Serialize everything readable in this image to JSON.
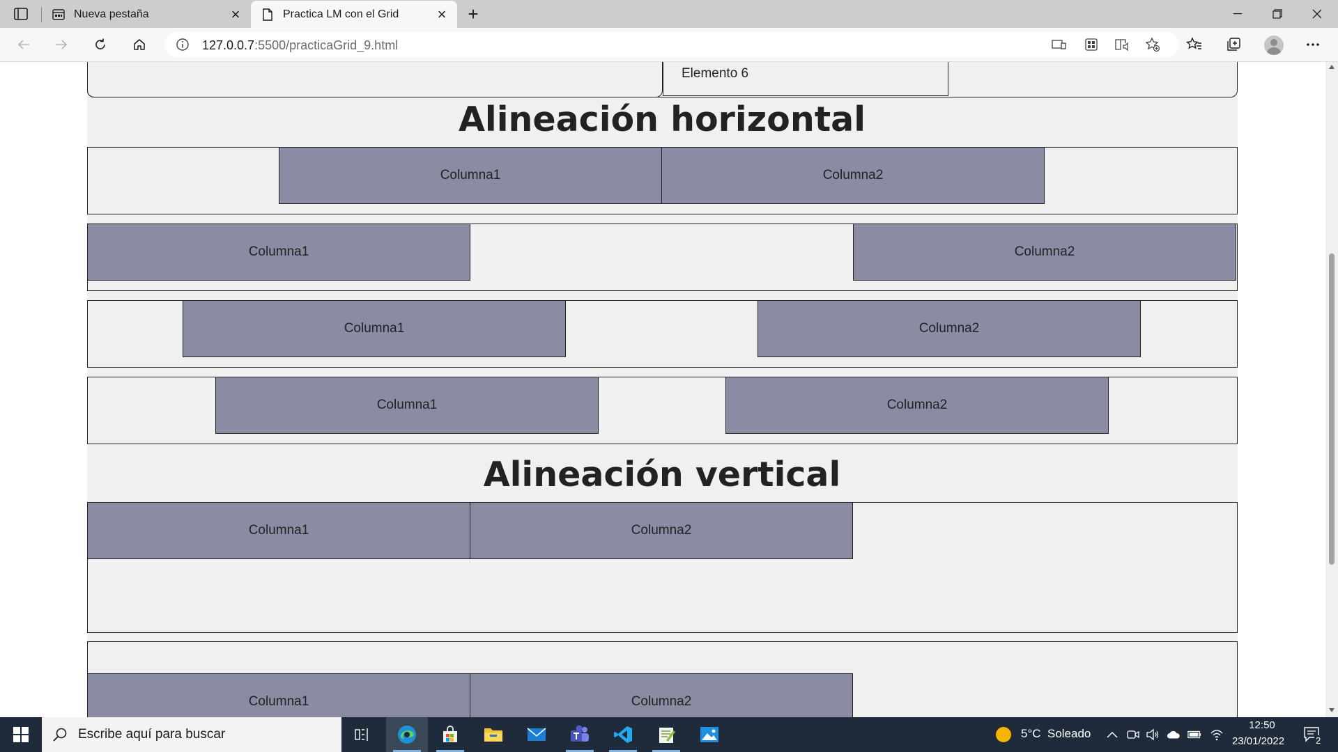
{
  "browser": {
    "tabs": [
      {
        "title": "Nueva pestaña",
        "active": false
      },
      {
        "title": "Practica LM con el Grid",
        "active": true
      }
    ],
    "url_host": "127.0.0.7",
    "url_path": ":5500/practicaGrid_9.html"
  },
  "page": {
    "top_element_label": "Elemento 6",
    "heading_horizontal": "Alineación horizontal",
    "heading_vertical": "Alineación vertical",
    "column1_label": "Columna1",
    "column2_label": "Columna2"
  },
  "taskbar": {
    "search_placeholder": "Escribe aquí para buscar",
    "weather": "5°C  Soleado",
    "time": "12:50",
    "date": "23/01/2022",
    "notifications_count": "2"
  },
  "colors": {
    "column_fill": "#8a8ca3",
    "page_background": "#f0f0f0",
    "taskbar": "#1f2b3a"
  }
}
